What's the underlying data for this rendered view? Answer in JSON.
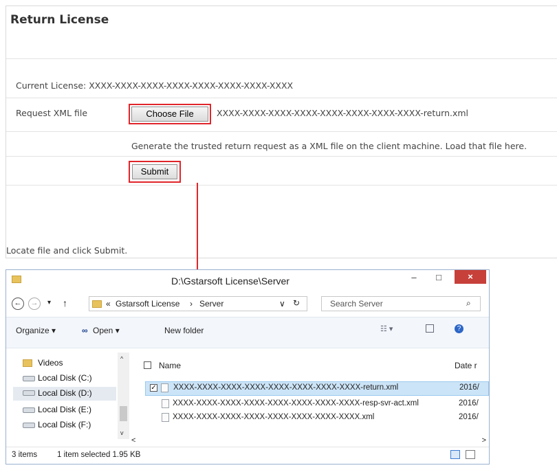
{
  "panel": {
    "title": "Return License",
    "current_license_text": "Current License:  XXXX-XXXX-XXXX-XXXX-XXXX-XXXX-XXXX-XXXX",
    "request_label": "Request XML file",
    "choose_file_label": "Choose File",
    "selected_file": "XXXX-XXXX-XXXX-XXXX-XXXX-XXXX-XXXX-XXXX-return.xml",
    "help_text": "Generate the trusted return request as a XML file on the client machine. Load that file here.",
    "submit_label": "Submit",
    "footer_text": "Locate file and click Submit.",
    "highlight_color": "#e0242a"
  },
  "explorer": {
    "title": "D:\\Gstarsoft License\\Server",
    "minimize": "–",
    "maximize": "□",
    "close": "×",
    "back_icon": "←",
    "forward_icon": "→",
    "recent_icon": "▾",
    "up_icon": "↑",
    "breadcrumb_prefix": "«",
    "breadcrumb_part1": "Gstarsoft License",
    "breadcrumb_sep": "›",
    "breadcrumb_part2": "Server",
    "address_dropdown": "∨",
    "refresh_icon": "↻",
    "search_placeholder": "Search Server",
    "search_icon": "⌕",
    "organize": "Organize ▾",
    "open": "Open ▾",
    "new_folder": "New folder",
    "nav": [
      "Videos",
      "Local Disk (C:)",
      "Local Disk (D:)",
      "Local Disk (E:)",
      "Local Disk (F:)"
    ],
    "col_name": "Name",
    "col_date": "Date r",
    "files": [
      {
        "name": "XXXX-XXXX-XXXX-XXXX-XXXX-XXXX-XXXX-XXXX-return.xml",
        "date": "2016/",
        "checked": true
      },
      {
        "name": "XXXX-XXXX-XXXX-XXXX-XXXX-XXXX-XXXX-XXXX-resp-svr-act.xml",
        "date": "2016/",
        "checked": false
      },
      {
        "name": "XXXX-XXXX-XXXX-XXXX-XXXX-XXXX-XXXX-XXXX.xml",
        "date": "2016/",
        "checked": false
      }
    ],
    "status_items": "3 items",
    "status_selected": "1 item selected  1.95 KB"
  }
}
